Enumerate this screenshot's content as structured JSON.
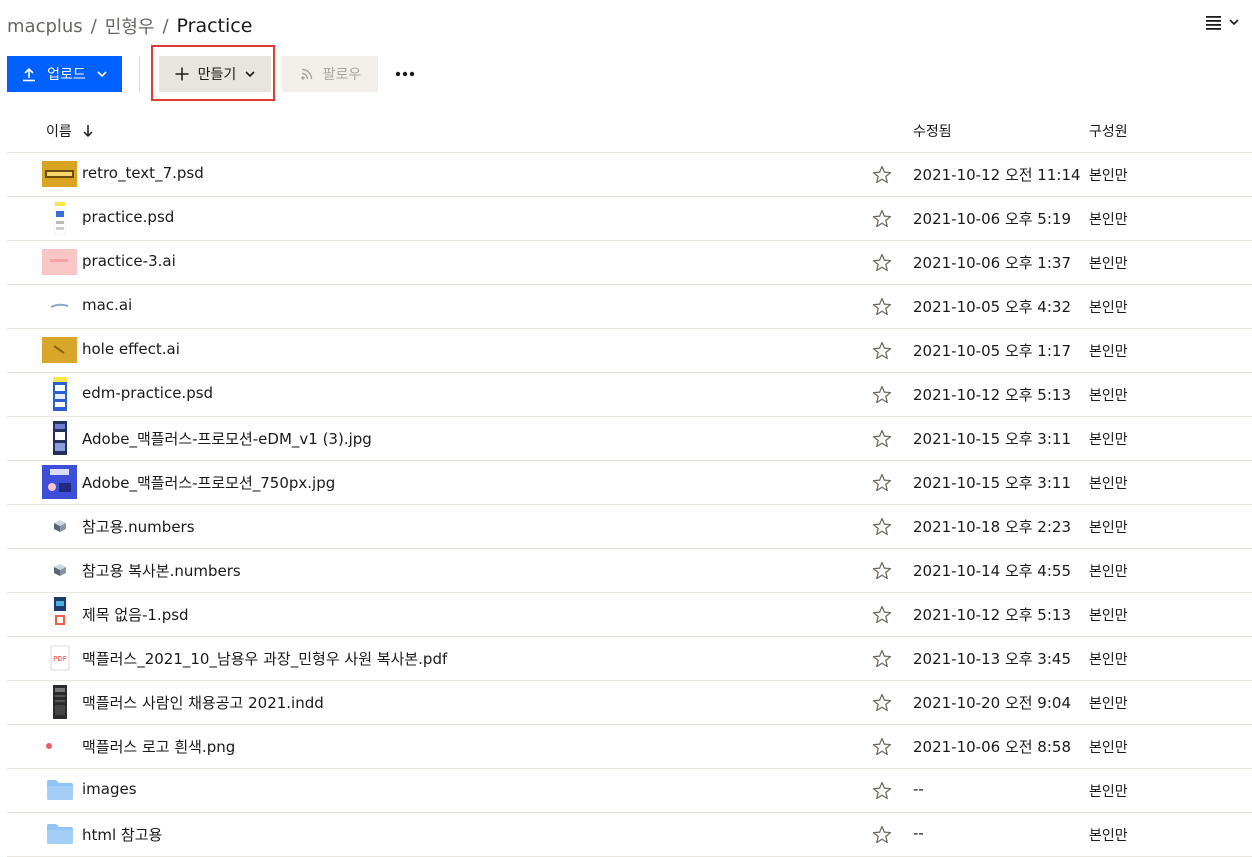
{
  "breadcrumb": {
    "root": "macplus",
    "user": "민형우",
    "current": "Practice",
    "separator": "/"
  },
  "toolbar": {
    "upload_label": "업로드",
    "create_label": "만들기",
    "follow_label": "팔로우"
  },
  "table": {
    "col_name": "이름",
    "col_modified": "수정됨",
    "col_members": "구성원",
    "rows": [
      {
        "name": "retro_text_7.psd",
        "modified": "2021-10-12 오전 11:14",
        "members": "본인만",
        "thumb": "retro-psd-thumbnail"
      },
      {
        "name": "practice.psd",
        "modified": "2021-10-06 오후 5:19",
        "members": "본인만",
        "thumb": "practice-psd-thumbnail"
      },
      {
        "name": "practice-3.ai",
        "modified": "2021-10-06 오후 1:37",
        "members": "본인만",
        "thumb": "practice3-ai-thumbnail"
      },
      {
        "name": "mac.ai",
        "modified": "2021-10-05 오후 4:32",
        "members": "본인만",
        "thumb": "mac-ai-thumbnail"
      },
      {
        "name": "hole effect.ai",
        "modified": "2021-10-05 오후 1:17",
        "members": "본인만",
        "thumb": "hole-effect-thumbnail"
      },
      {
        "name": "edm-practice.psd",
        "modified": "2021-10-12 오후 5:13",
        "members": "본인만",
        "thumb": "edm-psd-thumbnail"
      },
      {
        "name": "Adobe_맥플러스-프로모션-eDM_v1 (3).jpg",
        "modified": "2021-10-15 오후 3:11",
        "members": "본인만",
        "thumb": "edm-jpg-thumbnail"
      },
      {
        "name": "Adobe_맥플러스-프로모션_750px.jpg",
        "modified": "2021-10-15 오후 3:11",
        "members": "본인만",
        "thumb": "promo-jpg-thumbnail"
      },
      {
        "name": "참고용.numbers",
        "modified": "2021-10-18 오후 2:23",
        "members": "본인만",
        "thumb": "numbers-icon"
      },
      {
        "name": "참고용 복사본.numbers",
        "modified": "2021-10-14 오후 4:55",
        "members": "본인만",
        "thumb": "numbers-icon"
      },
      {
        "name": "제목 없음-1.psd",
        "modified": "2021-10-12 오후 5:13",
        "members": "본인만",
        "thumb": "untitled-psd-thumbnail"
      },
      {
        "name": "맥플러스_2021_10_남용우 과장_민형우 사원 복사본.pdf",
        "modified": "2021-10-13 오후 3:45",
        "members": "본인만",
        "thumb": "pdf-icon"
      },
      {
        "name": "맥플러스 사람인 채용공고 2021.indd",
        "modified": "2021-10-20 오전 9:04",
        "members": "본인만",
        "thumb": "indd-thumbnail"
      },
      {
        "name": "맥플러스 로고 흰색.png",
        "modified": "2021-10-06 오전 8:58",
        "members": "본인만",
        "thumb": "logo-png-thumbnail"
      },
      {
        "name": "images",
        "modified": "--",
        "members": "본인만",
        "thumb": "folder-icon"
      },
      {
        "name": "html 참고용",
        "modified": "--",
        "members": "본인만",
        "thumb": "folder-icon"
      }
    ]
  },
  "colors": {
    "primary": "#0061fe",
    "highlight": "#e03a3a",
    "folder": "#8fc4f5"
  }
}
